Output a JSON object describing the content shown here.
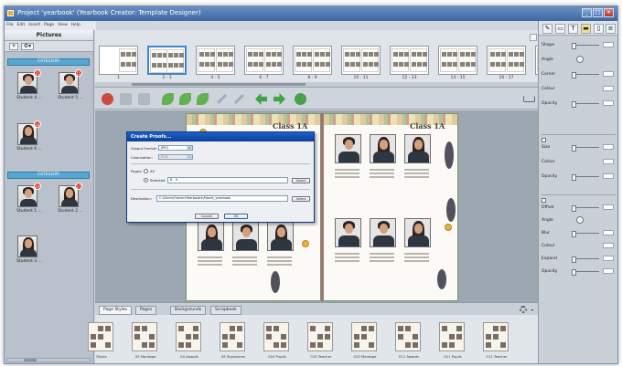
{
  "window": {
    "title": "Project 'yearbook' (Yearbook Creator: Template Designer)",
    "controls": {
      "minimize": "_",
      "maximize": "□",
      "close": "✕"
    }
  },
  "menu": [
    "File",
    "Edit",
    "Insert",
    "Page",
    "View",
    "Help"
  ],
  "pictures_panel": {
    "title": "Pictures",
    "add_label": "+",
    "settings_label": "⚙▾",
    "groups": [
      {
        "name": "CATEGORY",
        "items": [
          {
            "label": "Student 4 ...",
            "badge": "21",
            "hair": "short"
          },
          {
            "label": "Student 5 ...",
            "badge": "15",
            "hair": "short"
          },
          {
            "label": "Student 6 ...",
            "badge": "18",
            "hair": "long"
          }
        ]
      },
      {
        "name": "CATEGORY",
        "items": [
          {
            "label": "Student 1 ...",
            "badge": "19",
            "hair": "short"
          },
          {
            "label": "Student 2 ...",
            "badge": "17",
            "hair": "long"
          },
          {
            "label": "Student 3 ...",
            "badge": "",
            "hair": "long"
          }
        ]
      }
    ]
  },
  "spreads": [
    "1",
    "2 - 3",
    "4 - 5",
    "6 - 7",
    "8 - 9",
    "10 - 11",
    "12 - 13",
    "14 - 15",
    "16 - 17",
    "18 - 19"
  ],
  "selected_spread": "2 - 3",
  "pages": {
    "left_title": "Class 1A",
    "right_title": "Class 1A"
  },
  "dialog": {
    "title": "Create Proofs...",
    "output_format_label": "Output Format:",
    "output_format_value": "JPEG",
    "colorization_label": "Colorization:",
    "colorization_value": "RGB",
    "pages_label": "Pages:",
    "all_label": "All",
    "selected_label": "Selected",
    "selected_value": "8 - 9",
    "select_button": "Select",
    "destination_label": "Destination:",
    "destination_value": "C:\\Users\\Owner\\Yearbooks\\Proofs_yearbook",
    "select_button_2": "Select",
    "cancel_button": "Cancel",
    "ok_button": "OK"
  },
  "bottom_tabs": [
    "Page Styles",
    "Pages",
    "Backgrounds",
    "Scrapbook"
  ],
  "active_bottom_tab": "Page Styles",
  "page_styles": [
    "Styles",
    "03 Montage",
    "04 Awards",
    "05 Signatures",
    "010 Pupils",
    "010 Teacher",
    "010 Montage",
    "011 Awards",
    "011 Pupils",
    "011 Teacher"
  ],
  "properties": {
    "section1": [
      {
        "label": "Shape",
        "control": "slider"
      },
      {
        "label": "Angle",
        "control": "dial"
      },
      {
        "label": "Corner",
        "control": "slider"
      },
      {
        "label": "Colour",
        "control": "box"
      },
      {
        "label": "Opacity",
        "control": "slider"
      }
    ],
    "section2": [
      {
        "label": "Size",
        "control": "slider"
      },
      {
        "label": "Colour",
        "control": "box"
      },
      {
        "label": "Opacity",
        "control": "slider"
      }
    ],
    "section3": [
      {
        "label": "Offset",
        "control": "slider"
      },
      {
        "label": "Angle",
        "control": "dial"
      },
      {
        "label": "Blur",
        "control": "slider"
      },
      {
        "label": "Colour",
        "control": "box"
      },
      {
        "label": "Expand",
        "control": "slider"
      },
      {
        "label": "Opacity",
        "control": "slider"
      }
    ]
  },
  "colors": {
    "accent": "#3d67a4",
    "category": "#55a6d2",
    "dialog_title": "#0b3f9a",
    "badge": "#d8322d"
  }
}
